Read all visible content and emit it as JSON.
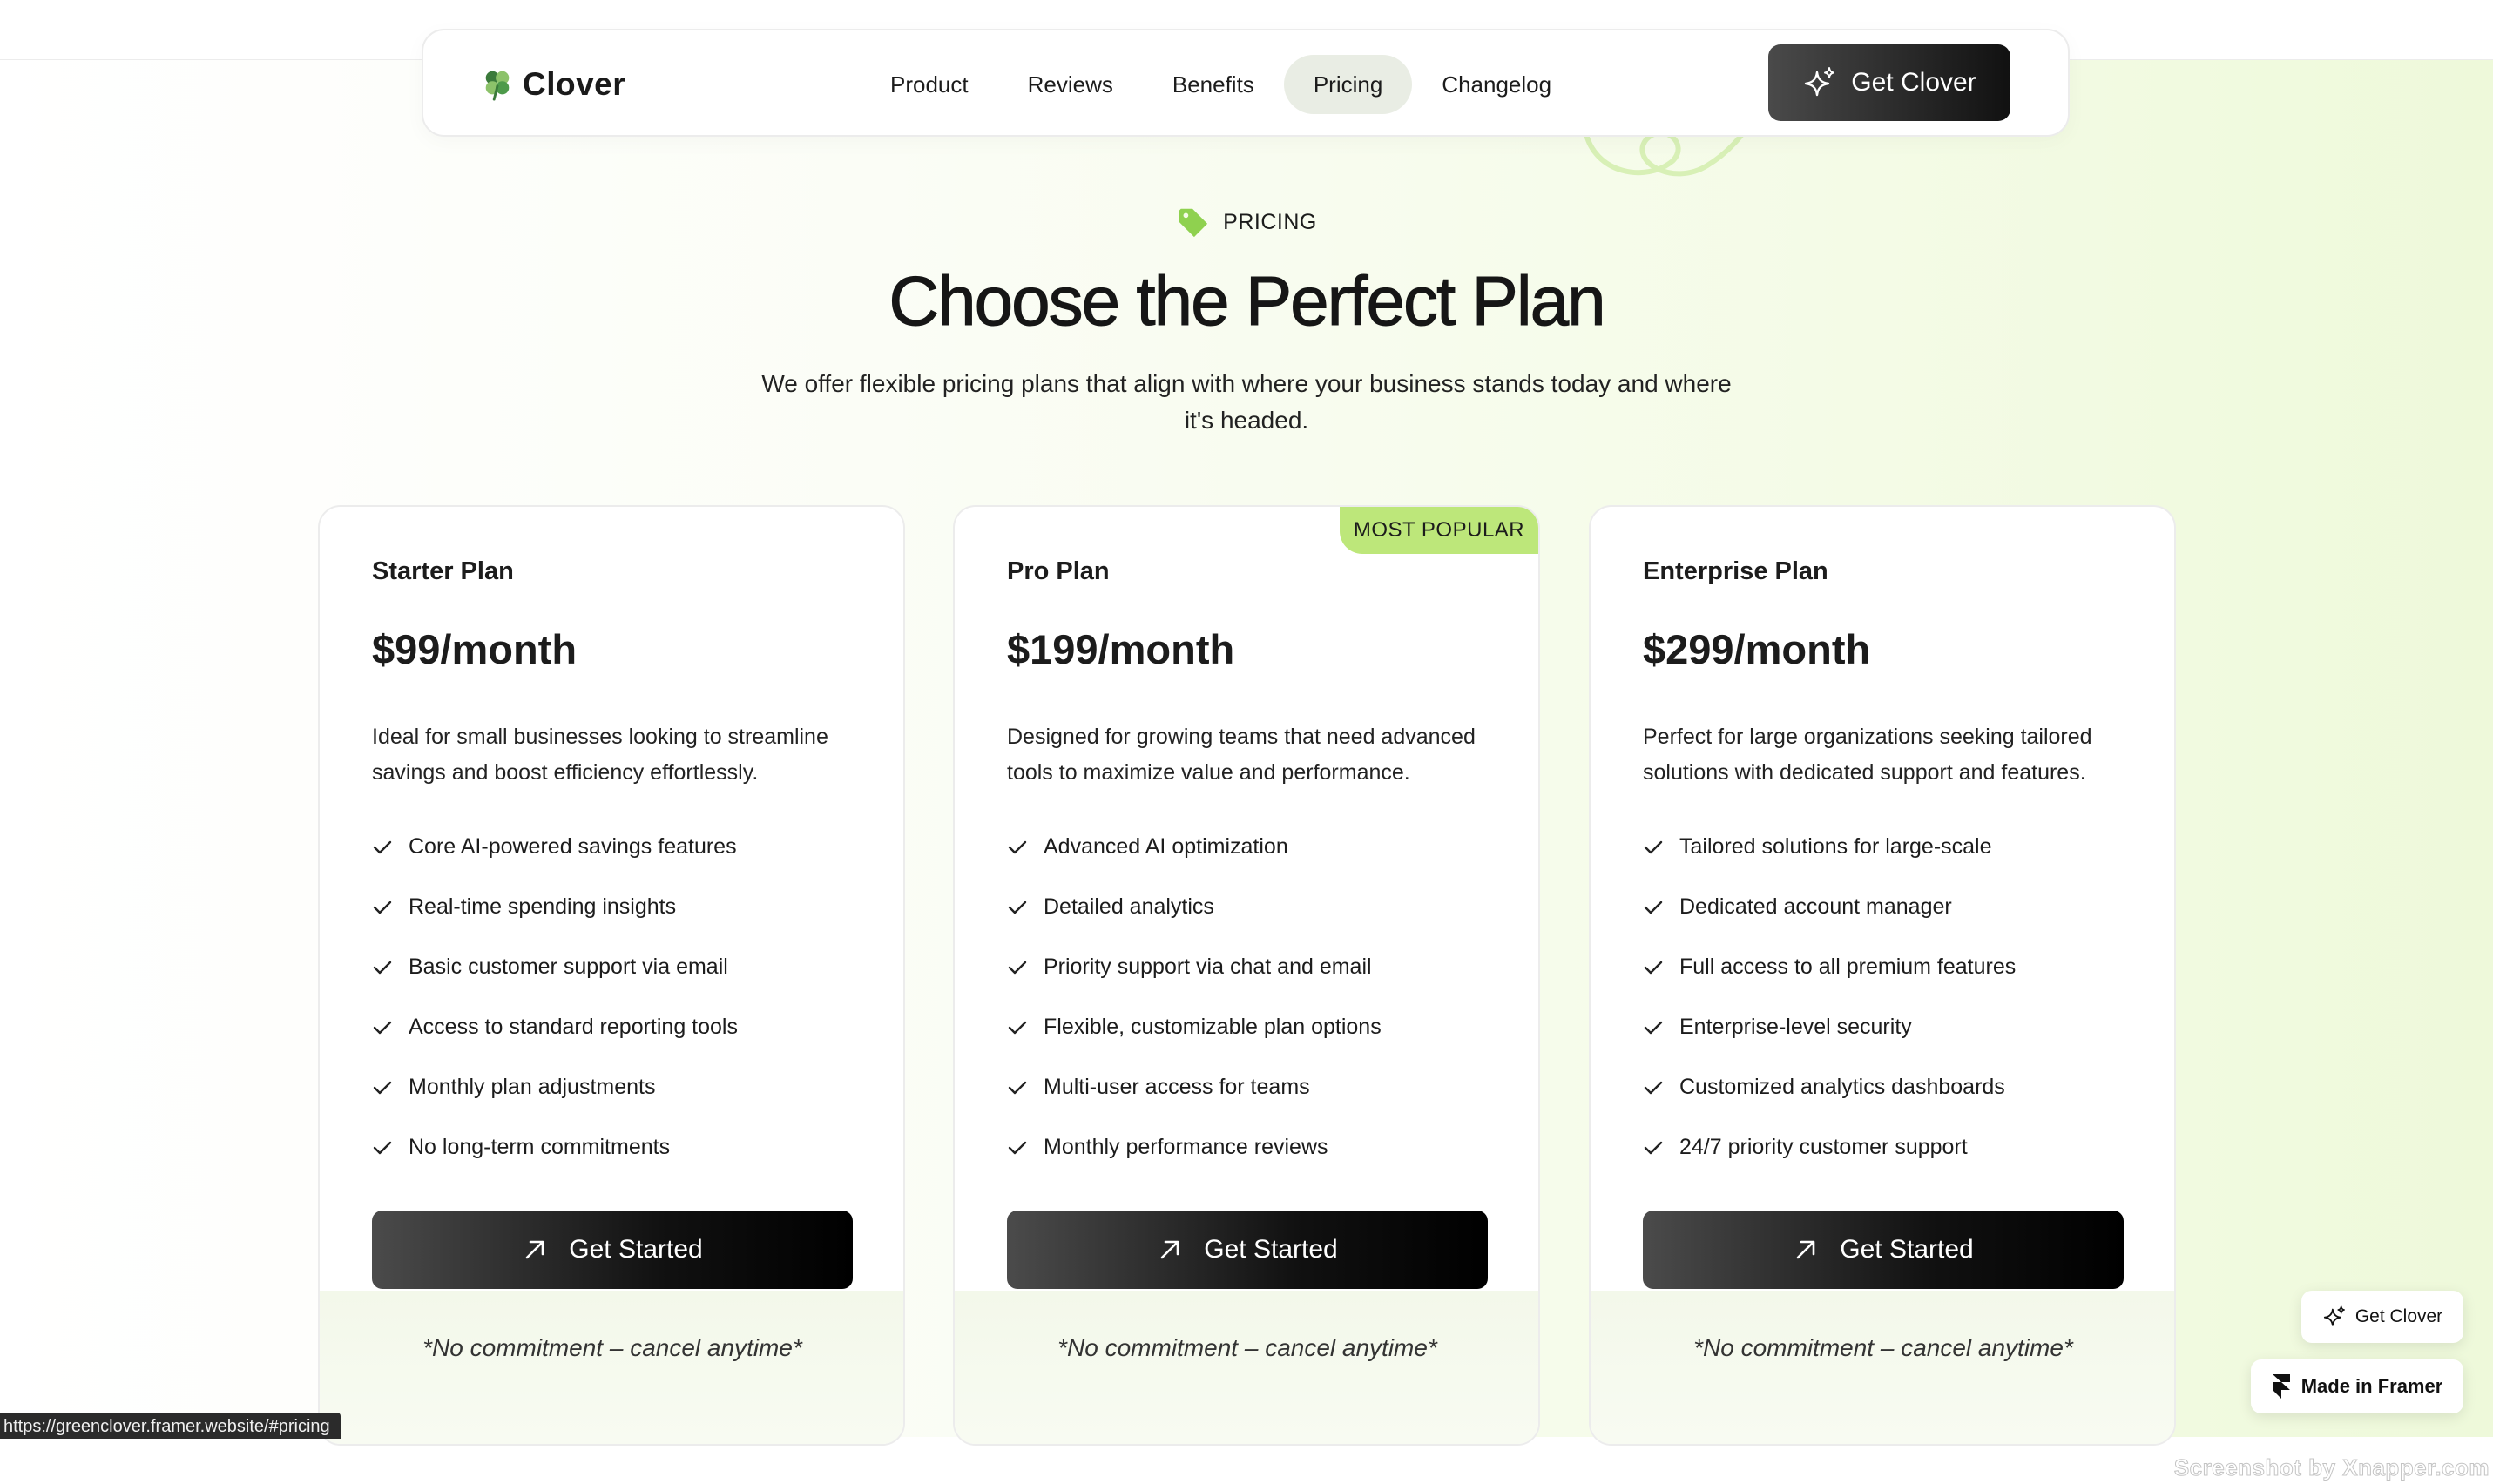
{
  "nav": {
    "logo_text": "Clover",
    "links": [
      "Product",
      "Reviews",
      "Benefits",
      "Pricing",
      "Changelog"
    ],
    "active_link": "Pricing",
    "cta_label": "Get Clover"
  },
  "hero": {
    "eyebrow": "PRICING",
    "title": "Choose the Perfect Plan",
    "subtitle": "We offer flexible pricing plans that align with where your business stands today and where it's headed."
  },
  "plans": [
    {
      "name": "Starter Plan",
      "price": "$99/month",
      "description": "Ideal for small businesses looking to streamline savings and boost efficiency effortlessly.",
      "features": [
        "Core AI-powered savings features",
        "Real-time spending insights",
        "Basic customer support via email",
        "Access to standard reporting tools",
        "Monthly plan adjustments",
        "No long-term commitments"
      ],
      "cta_label": "Get Started",
      "note": "*No commitment – cancel anytime*"
    },
    {
      "name": "Pro Plan",
      "badge": "MOST POPULAR",
      "price": "$199/month",
      "description": "Designed for growing teams that need advanced tools to maximize value and performance.",
      "features": [
        "Advanced AI optimization",
        "Detailed analytics",
        "Priority support via chat and email",
        "Flexible, customizable plan options",
        "Multi-user access for teams",
        "Monthly performance reviews"
      ],
      "cta_label": "Get Started",
      "note": "*No commitment – cancel anytime*"
    },
    {
      "name": "Enterprise Plan",
      "price": "$299/month",
      "description": "Perfect for large organizations seeking tailored solutions with dedicated support and features.",
      "features": [
        "Tailored solutions for large-scale",
        "Dedicated account manager",
        "Full access to all premium features",
        "Enterprise-level security",
        "Customized analytics dashboards",
        "24/7 priority customer support"
      ],
      "cta_label": "Get Started",
      "note": "*No commitment – cancel anytime*"
    }
  ],
  "floating": {
    "cta_label": "Get Clover",
    "framer_label": "Made in Framer"
  },
  "status_url": "https://greenclover.framer.website/#pricing",
  "watermark": "Screenshot by Xnapper.com",
  "colors": {
    "accent_green": "#bde77a",
    "tag_green": "#8fd14f",
    "button_dark": "#111111",
    "background_tint": "#eef9da"
  },
  "icons": {
    "logo": "clover-icon",
    "nav_cta": "sparkle-icon",
    "eyebrow": "tag-icon",
    "feature": "check-icon",
    "plan_cta": "arrow-up-right-icon",
    "framer": "framer-icon"
  }
}
